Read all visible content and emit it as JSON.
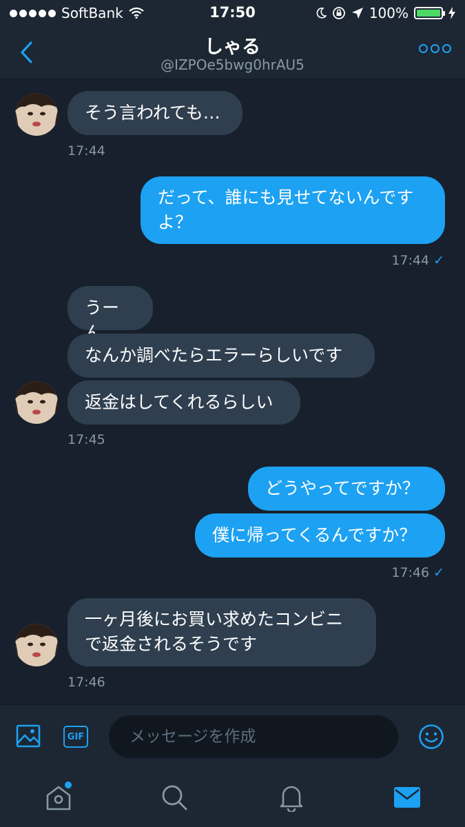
{
  "status_bar": {
    "carrier": "SoftBank",
    "time": "17:50",
    "battery": "100%",
    "battery_level": 1.0
  },
  "header": {
    "name": "しゃる",
    "handle": "@IZPOe5bwg0hrAU5",
    "back_icon": "chevron-left-icon",
    "more_icon": "more-dots-icon"
  },
  "messages": [
    {
      "dir": "in",
      "text": "そう言われても…"
    },
    {
      "dir": "in_time",
      "text": "17:44"
    },
    {
      "dir": "out",
      "text": "だって、誰にも見せてないんですよ？"
    },
    {
      "dir": "out_time",
      "text": "17:44"
    },
    {
      "dir": "in",
      "text": "うーん"
    },
    {
      "dir": "in",
      "text": "なんか調べたらエラーらしいです"
    },
    {
      "dir": "in",
      "text": "返金はしてくれるらしい"
    },
    {
      "dir": "in_time",
      "text": "17:45"
    },
    {
      "dir": "out",
      "text": "どうやってですか？"
    },
    {
      "dir": "out",
      "text": "僕に帰ってくるんですか？"
    },
    {
      "dir": "out_time",
      "text": "17:46"
    },
    {
      "dir": "in",
      "text": "一ヶ月後にお買い求めたコンビニで返金されるそうです"
    },
    {
      "dir": "in_time",
      "text": "17:46"
    }
  ],
  "read_check": "✓",
  "composer": {
    "placeholder": "メッセージを作成",
    "gif_label": "GIF",
    "image_icon": "image-icon",
    "emoji_icon": "smiley-icon"
  },
  "tabbar": {
    "items": [
      "home-icon",
      "search-icon",
      "bell-icon",
      "mail-icon"
    ],
    "active": "mail-icon"
  },
  "colors": {
    "background": "#17202c",
    "bar": "#1c2733",
    "incoming_bubble": "#2f3f50",
    "outgoing_bubble": "#1da1f2",
    "accent": "#1da1f2",
    "muted_text": "#8899a6"
  }
}
